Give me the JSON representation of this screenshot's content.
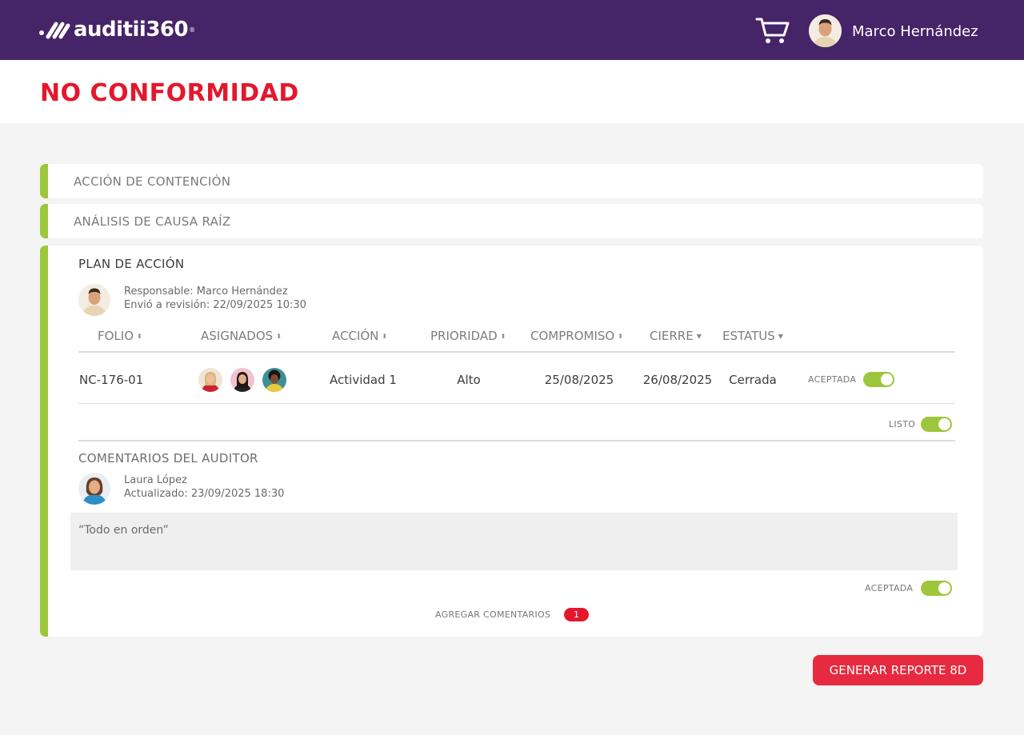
{
  "header": {
    "brand": "auditii360",
    "brand_reg": "®",
    "cart_icon": "shopping-cart-icon",
    "user_name": "Marco Hernández"
  },
  "page": {
    "title": "NO CONFORMIDAD"
  },
  "sections": {
    "containment": {
      "label": "ACCIÓN DE CONTENCIÓN"
    },
    "root_cause": {
      "label": "ANÁLISIS DE CAUSA RAÍZ"
    },
    "action_plan": {
      "title": "PLAN DE ACCIÓN",
      "responsible": "Responsable: Marco Hernández",
      "sent": "Envió a revisión: 22/09/2025 10:30",
      "columns": {
        "folio": "FOLIO",
        "asignados": "ASIGNADOS",
        "accion": "ACCIÓN",
        "prioridad": "PRIORIDAD",
        "compromiso": "COMPROMISO",
        "cierre": "CIERRE",
        "estatus": "ESTATUS"
      },
      "sort_glyph": "⬍",
      "filter_glyph": "▼",
      "rows": [
        {
          "folio": "NC-176-01",
          "assignees": [
            "avatar-woman-blonde",
            "avatar-woman-dark-hair",
            "avatar-man-curly"
          ],
          "accion": "Actividad 1",
          "prioridad": "Alto",
          "compromiso": "25/08/2025",
          "cierre": "26/08/2025",
          "estatus": "Cerrada",
          "toggle_label": "ACEPTADA",
          "toggle_on": true
        }
      ],
      "ready_label": "LISTO",
      "ready_on": true
    },
    "auditor_comments": {
      "title": "COMENTARIOS DEL AUDITOR",
      "author": "Laura López",
      "updated": "Actualizado: 23/09/2025 18:30",
      "comment": "“Todo en orden”",
      "accepted_label": "ACEPTADA",
      "accepted_on": true,
      "add_comments_label": "AGREGAR COMENTARIOS",
      "comment_count": "1"
    }
  },
  "actions": {
    "report_button": "GENERAR REPORTE 8D"
  },
  "colors": {
    "header_bg": "#452468",
    "title_red": "#e3182d",
    "accent_green": "#9dc63c",
    "button_red": "#e72a3f"
  }
}
